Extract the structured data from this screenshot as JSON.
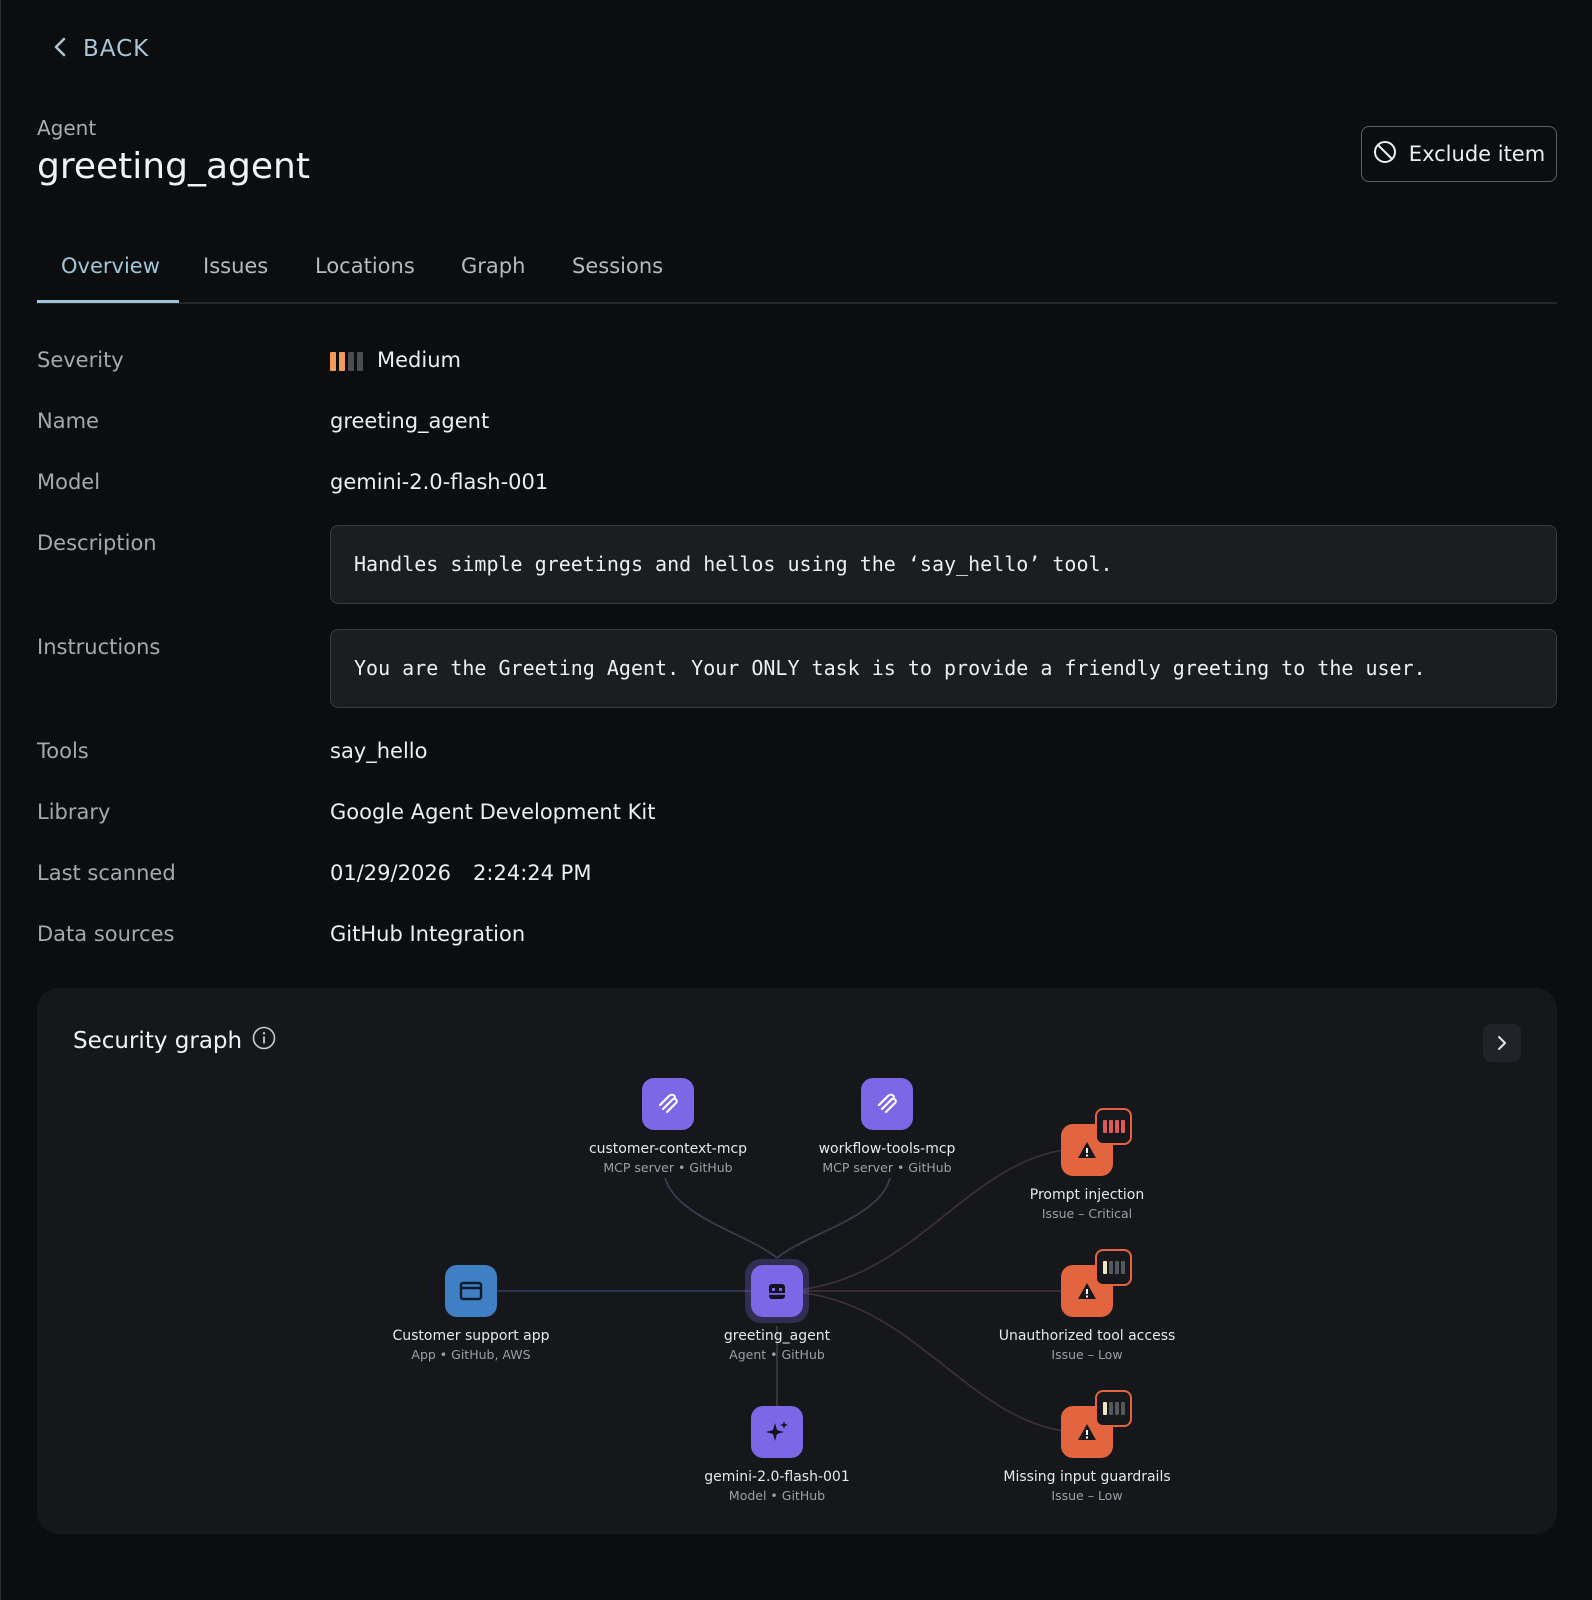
{
  "nav": {
    "back_label": "BACK"
  },
  "header": {
    "kind": "Agent",
    "title": "greeting_agent",
    "exclude_label": "Exclude item"
  },
  "tabs": [
    {
      "label": "Overview",
      "active": true
    },
    {
      "label": "Issues",
      "active": false
    },
    {
      "label": "Locations",
      "active": false
    },
    {
      "label": "Graph",
      "active": false
    },
    {
      "label": "Sessions",
      "active": false
    }
  ],
  "details": {
    "severity": {
      "label": "Severity",
      "value": "Medium",
      "level": 2,
      "max": 4
    },
    "name": {
      "label": "Name",
      "value": "greeting_agent"
    },
    "model": {
      "label": "Model",
      "value": "gemini-2.0-flash-001"
    },
    "description": {
      "label": "Description",
      "value": "Handles simple greetings and hellos using the ‘say_hello’ tool."
    },
    "instructions": {
      "label": "Instructions",
      "value": "You are the Greeting Agent. Your ONLY task is to provide a friendly greeting to the user."
    },
    "tools": {
      "label": "Tools",
      "value": "say_hello"
    },
    "library": {
      "label": "Library",
      "value": "Google Agent Development Kit"
    },
    "last_scanned": {
      "label": "Last scanned",
      "date": "01/29/2026",
      "time": "2:24:24 PM"
    },
    "data_sources": {
      "label": "Data sources",
      "value": "GitHub Integration"
    }
  },
  "security_graph": {
    "title": "Security graph",
    "nodes": {
      "mcp1": {
        "label": "customer-context-mcp",
        "sub": "MCP server • GitHub",
        "icon": "mcp-icon"
      },
      "mcp2": {
        "label": "workflow-tools-mcp",
        "sub": "MCP server • GitHub",
        "icon": "mcp-icon"
      },
      "app": {
        "label": "Customer support app",
        "sub": "App • GitHub, AWS",
        "icon": "window-icon"
      },
      "agent": {
        "label": "greeting_agent",
        "sub": "Agent • GitHub",
        "icon": "robot-icon"
      },
      "model": {
        "label": "gemini-2.0-flash-001",
        "sub": "Model • GitHub",
        "icon": "sparkle-icon"
      },
      "issue1": {
        "label": "Prompt injection",
        "sub": "Issue – Critical",
        "severity_level": 4,
        "icon": "warning-icon"
      },
      "issue2": {
        "label": "Unauthorized tool access",
        "sub": "Issue – Low",
        "severity_level": 1,
        "icon": "warning-icon"
      },
      "issue3": {
        "label": "Missing input guardrails",
        "sub": "Issue – Low",
        "severity_level": 1,
        "icon": "warning-icon"
      }
    }
  },
  "colors": {
    "accent": "#9fc6d8",
    "purple_node": "#7c68e6",
    "app_node": "#3f7fc4",
    "issue_node": "#e2653f",
    "severity_medium": "#f29a57",
    "severity_critical": "#e05a5a"
  }
}
